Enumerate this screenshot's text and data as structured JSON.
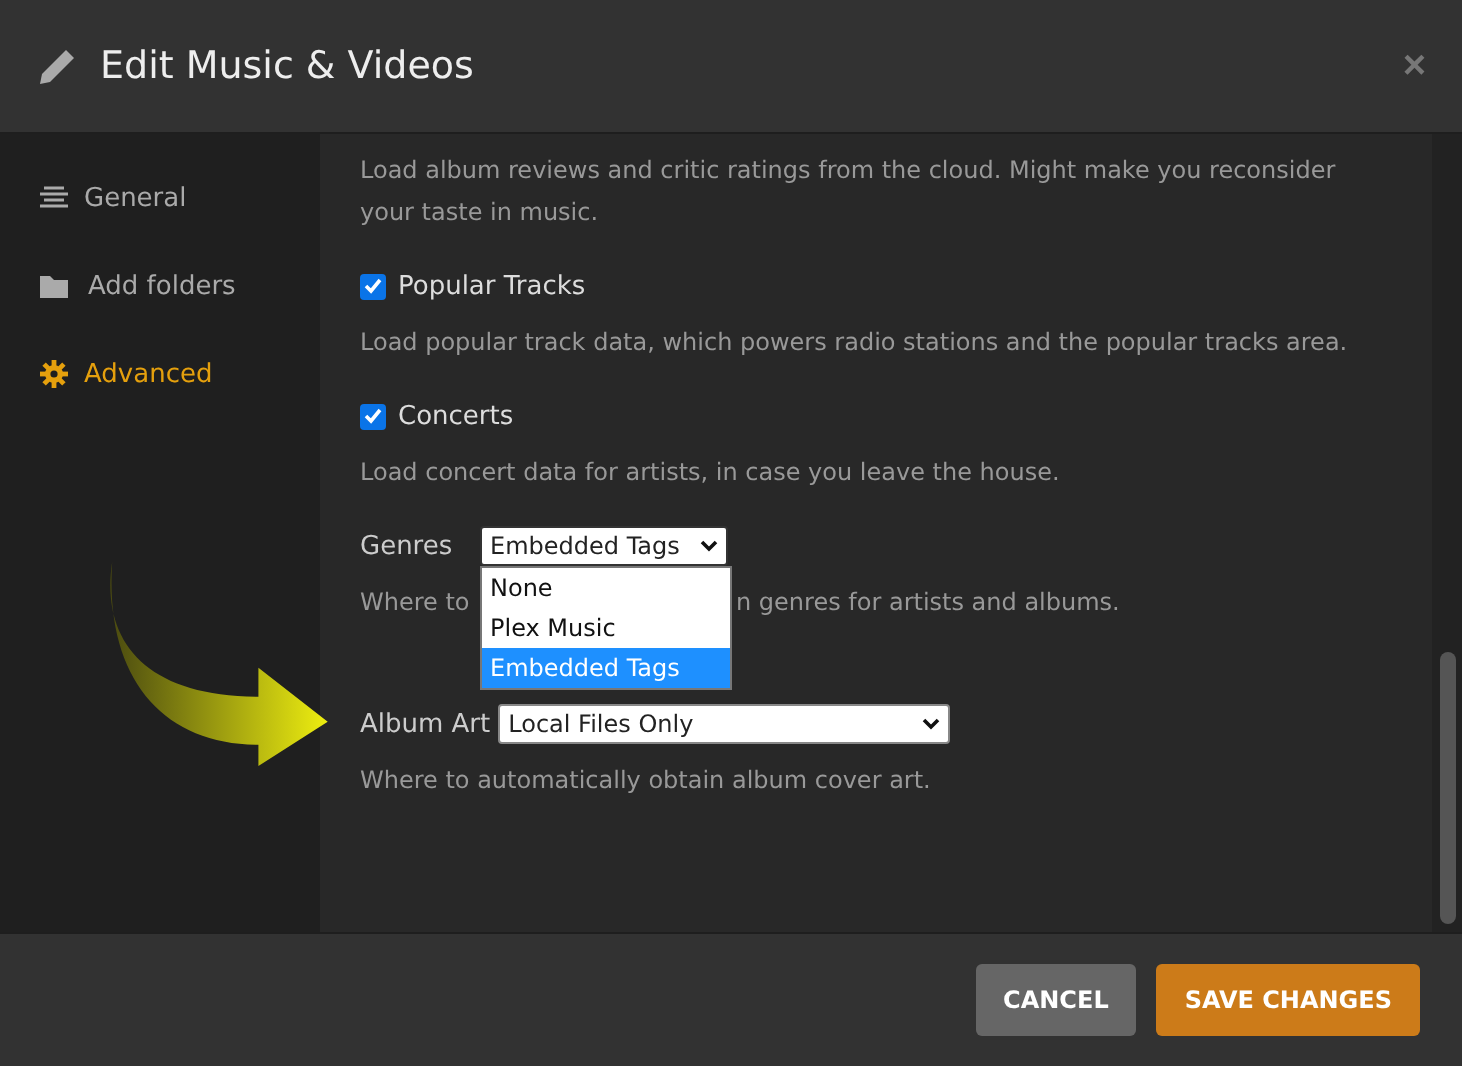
{
  "window": {
    "title": "Edit Music & Videos",
    "close": "×"
  },
  "sidebar": {
    "items": [
      {
        "label": "General",
        "selected": false
      },
      {
        "label": "Add folders",
        "selected": false
      },
      {
        "label": "Advanced",
        "selected": true
      }
    ]
  },
  "settings": [
    {
      "kind": "text",
      "text": "Load album reviews and critic ratings from the cloud. Might make you reconsider your taste in music."
    },
    {
      "kind": "checkbox",
      "label": "Popular Tracks",
      "checked": true,
      "hint": "Load popular track data, which powers radio stations and the popular tracks area."
    },
    {
      "kind": "checkbox",
      "label": "Concerts",
      "checked": true,
      "hint": "Load concert data for artists, in case you leave the house."
    },
    {
      "kind": "select",
      "label": "Genres",
      "value": "Embedded Tags",
      "expanded": true,
      "options": [
        {
          "label": "None",
          "selected": false
        },
        {
          "label": "Plex Music",
          "selected": false
        },
        {
          "label": "Embedded Tags",
          "selected": true
        }
      ],
      "hint": "Where to",
      "hint_tail": "n genres for artists and albums."
    },
    {
      "kind": "select",
      "label": "Album Art",
      "value": "Local Files Only",
      "hint": "Where to automatically obtain album cover art."
    }
  ],
  "buttons": [
    {
      "label": "CANCEL",
      "kind": "secondary"
    },
    {
      "label": "SAVE CHANGES",
      "kind": "primary"
    }
  ]
}
